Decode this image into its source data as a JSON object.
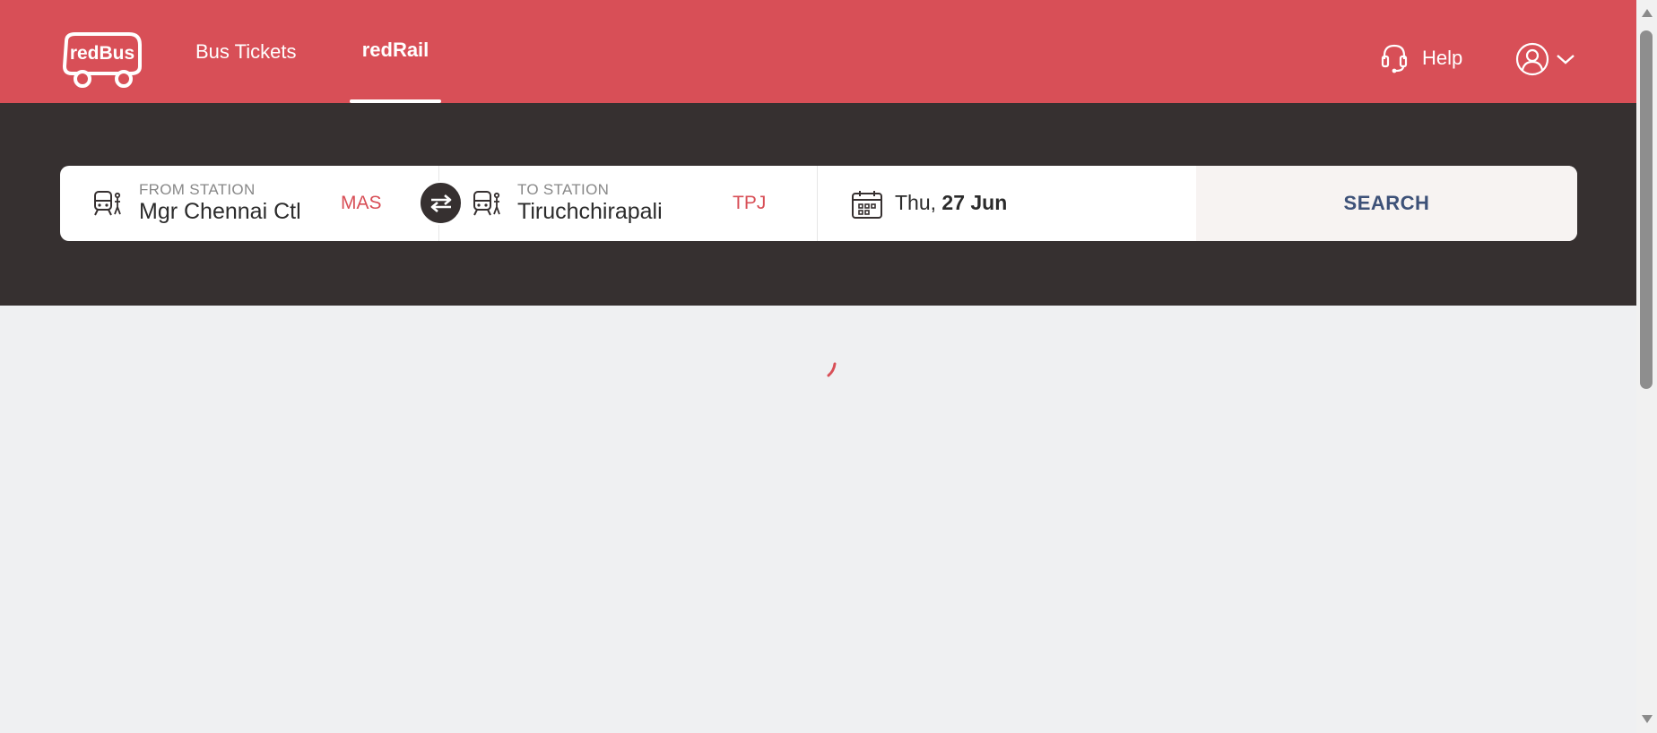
{
  "header": {
    "logo_text": "redBus",
    "nav": [
      {
        "label": "Bus Tickets",
        "active": false
      },
      {
        "label": "redRail",
        "active": true
      }
    ],
    "help_label": "Help",
    "brand_color": "#d84f57"
  },
  "search": {
    "from": {
      "label": "FROM STATION",
      "name": "Mgr Chennai Ctl",
      "code": "MAS"
    },
    "to": {
      "label": "TO STATION",
      "name": "Tiruchchirapali",
      "code": "TPJ"
    },
    "date": {
      "day": "Thu,",
      "date": "27 Jun"
    },
    "button_label": "SEARCH"
  },
  "icons": [
    "redbus-logo-icon",
    "headset-icon",
    "user-account-icon",
    "chevron-down-icon",
    "train-station-icon",
    "swap-icon",
    "calendar-icon",
    "loading-spinner-icon"
  ],
  "colors": {
    "band": "#363030",
    "page_bg": "#eff0f2",
    "search_text": "#3d5178"
  }
}
